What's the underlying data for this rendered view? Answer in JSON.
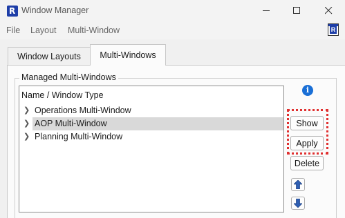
{
  "window": {
    "title": "Window Manager",
    "app_icon_letter": "R"
  },
  "menu": {
    "items": [
      "File",
      "Layout",
      "Multi-Window"
    ]
  },
  "tabs": [
    {
      "label": "Window Layouts",
      "active": false
    },
    {
      "label": "Multi-Windows",
      "active": true
    }
  ],
  "group": {
    "label": "Managed Multi-Windows"
  },
  "tree": {
    "header": "Name / Window Type",
    "rows": [
      {
        "label": "Operations Multi-Window",
        "selected": false
      },
      {
        "label": "AOP Multi-Window",
        "selected": true
      },
      {
        "label": "Planning Multi-Window",
        "selected": false
      }
    ]
  },
  "buttons": {
    "show": "Show",
    "apply": "Apply",
    "delete": "Delete"
  },
  "colors": {
    "accent": "#1e3ea8",
    "info": "#1a6fd6",
    "highlight": "#e03030",
    "selection": "#d9d9d9"
  }
}
